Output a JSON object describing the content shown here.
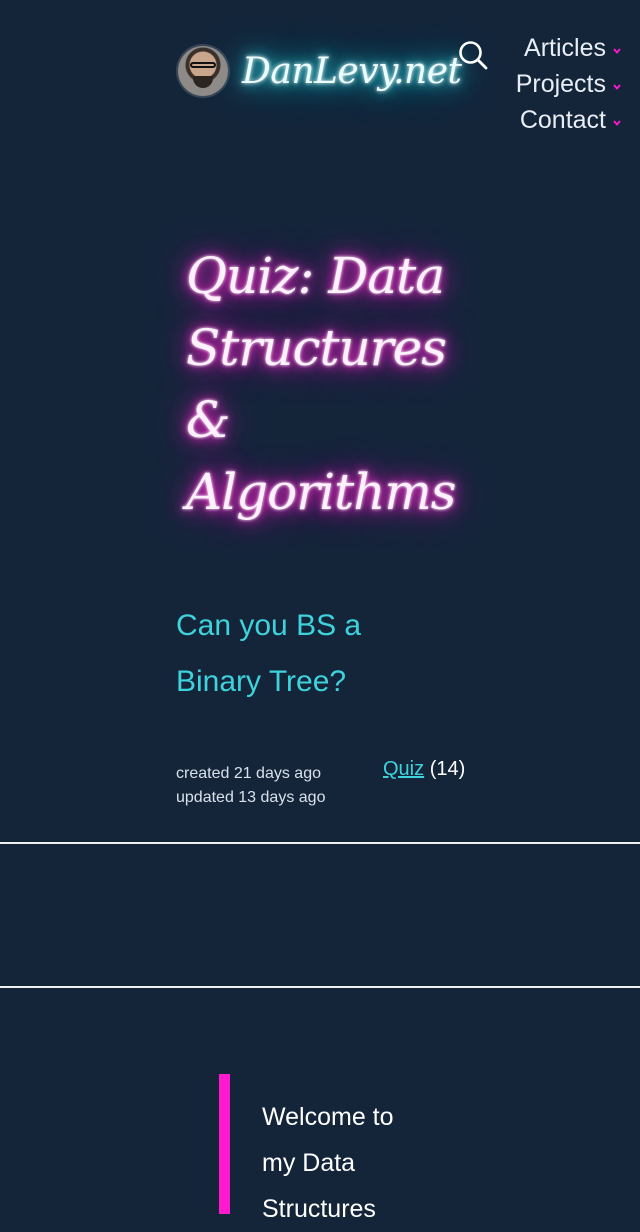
{
  "header": {
    "site_name": "DanLevy.net",
    "avatar_alt": "avatar",
    "nav": [
      {
        "label": "Articles"
      },
      {
        "label": "Projects"
      },
      {
        "label": "Contact"
      }
    ]
  },
  "article": {
    "title": "Quiz: Data Structures & Algorithms",
    "subtitle": "Can you BS a Binary Tree?",
    "created": "created 21 days ago",
    "updated": "updated 13 days ago",
    "tag": {
      "label": "Quiz",
      "count": "(14)"
    }
  },
  "intro": {
    "text": "Welcome to my Data Structures"
  },
  "icons": {
    "search": "search-icon",
    "chevron": "chevron-down-icon"
  },
  "colors": {
    "background": "#14253a",
    "accent_pink": "#ff19cf",
    "accent_cyan": "#3ed2dd"
  }
}
